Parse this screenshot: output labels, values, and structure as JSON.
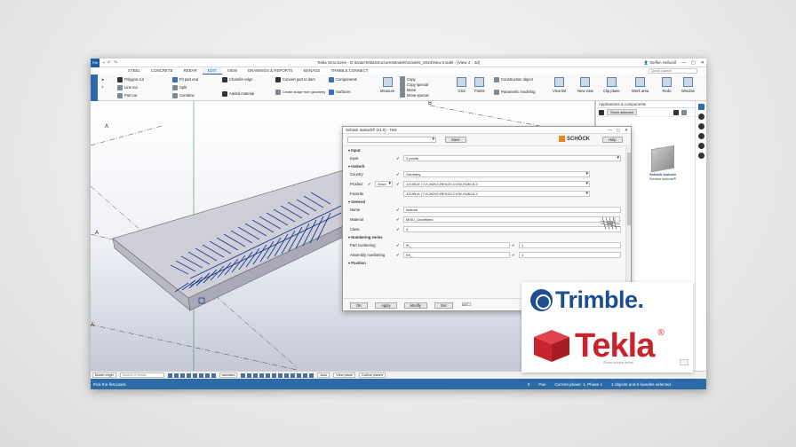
{
  "window": {
    "title": "Tekla Structures - D:\\Data\\TeklaStructuresModels\\models_2024\\New model - [View 2 - 3d]",
    "file_label": "File",
    "user": "Steffen Heßwolf",
    "controls": [
      "—",
      "▢",
      "✕"
    ]
  },
  "tabs": [
    {
      "label": "STEEL",
      "active": false
    },
    {
      "label": "CONCRETE",
      "active": false
    },
    {
      "label": "REBAR",
      "active": false
    },
    {
      "label": "EDIT",
      "active": true
    },
    {
      "label": "VIEW",
      "active": false
    },
    {
      "label": "DRAWINGS & REPORTS",
      "active": false
    },
    {
      "label": "MANAGE",
      "active": false
    },
    {
      "label": "TRIMBLE CONNECT",
      "active": false
    }
  ],
  "quick_launch": "Quick Launch",
  "ribbon": {
    "col1": [
      "Polygon cut",
      "Line cut",
      "Part cut"
    ],
    "col2": [
      "Fit part end",
      "Split",
      "Combine"
    ],
    "col3": [
      "Chamfer edge",
      "Added material"
    ],
    "col4": [
      "Convert part to item",
      "Create shape from geometry"
    ],
    "col5": [
      "Components",
      "Surfaces"
    ],
    "measure": "Measure",
    "col6": [
      "Copy",
      "Copy special",
      "Move",
      "Move special"
    ],
    "grid": "Grid",
    "points": "Points",
    "col7": [
      "Construction object",
      "Parametric modeling"
    ],
    "view_list": "View list",
    "new_view": "New view",
    "clip_plane": "Clip plane",
    "work_area": "Work area",
    "redo": "Redo",
    "window": "Window"
  },
  "viewport": {
    "grid_labels": [
      "B",
      "A",
      "A",
      "A",
      "A"
    ]
  },
  "panel": {
    "title": "Applications & components",
    "show_selected": "Show selected",
    "component_badge": "Schöck Isokorb",
    "component_name": "Schöck Isokorb®"
  },
  "dialog": {
    "title": "Schöck Isokorb® (v1.0) - Test",
    "save": "Save",
    "brand": "SCHÖCK",
    "help": "Help",
    "sections": {
      "input": "Input",
      "isokorb": "Isokorb",
      "general": "General",
      "numbering": "Numbering series",
      "position": "Position"
    },
    "fields": {
      "input_label": "Input",
      "input_value": "2 points",
      "country_label": "Country",
      "country_value": "Germany",
      "product_label": "Product",
      "product_mode": "Short",
      "product_value": "1219514 | T-K-M2V2-REI120-CV30-H180-6.2",
      "favorite_label": "Favorite",
      "favorite_value": "1219514 | T-K-M2V2-REI120-CV30-H180-6.2",
      "name_label": "Name",
      "name_value": "Isokorb",
      "material_label": "Material",
      "material_value": "MISC_Undefined",
      "class_label": "Class",
      "class_value": "4",
      "part_numbering_label": "Part numbering",
      "part_numbering_prefix": "IK_",
      "part_numbering_start": "1",
      "assembly_numbering_label": "Assembly numbering",
      "assembly_numbering_prefix": "EK_",
      "assembly_numbering_start": "1"
    },
    "footer": [
      "OK",
      "Apply",
      "Modify",
      "Get"
    ],
    "footer_icons": "☑/☐"
  },
  "statusbar": {
    "model_origin": "Model origin",
    "search": "Search in model",
    "standard": "standard",
    "auto": "Auto",
    "view_plane": "View plane",
    "outline_planes": "Outline planes",
    "prompt": "Pick the first point.",
    "pan_count": "0",
    "pan": "Pan",
    "phase": "Current phase: 1, Phase 1",
    "selection": "1 objects and 0 handles selected"
  },
  "logos": {
    "trimble": "Trimble.",
    "tekla": "Tekla",
    "registered": "®",
    "show_hidden": "Show hidden items"
  }
}
